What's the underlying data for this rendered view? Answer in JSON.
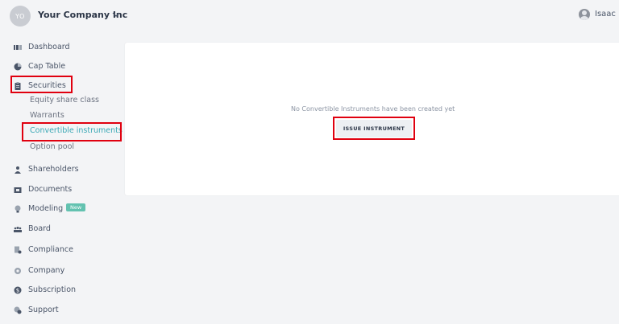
{
  "header": {
    "company_initials": "YO",
    "company_name": "Your Company Inc",
    "user_name": "Isaac"
  },
  "sidebar": {
    "items": [
      {
        "label": "Dashboard",
        "icon": "dashboard-icon"
      },
      {
        "label": "Cap Table",
        "icon": "pie-chart-icon"
      },
      {
        "label": "Securities",
        "icon": "clipboard-icon"
      },
      {
        "label": "Shareholders",
        "icon": "person-icon"
      },
      {
        "label": "Documents",
        "icon": "folder-icon"
      },
      {
        "label": "Modeling",
        "icon": "lightbulb-icon",
        "badge": "New"
      },
      {
        "label": "Board",
        "icon": "group-icon"
      },
      {
        "label": "Compliance",
        "icon": "document-check-icon"
      },
      {
        "label": "Company",
        "icon": "gear-icon"
      },
      {
        "label": "Subscription",
        "icon": "dollar-icon"
      },
      {
        "label": "Support",
        "icon": "support-icon"
      }
    ],
    "securities_sub": [
      {
        "label": "Equity share class"
      },
      {
        "label": "Warrants"
      },
      {
        "label": "Convertible instruments",
        "active": true
      },
      {
        "label": "Option pool"
      }
    ]
  },
  "main": {
    "empty_message": "No Convertible Instruments have been created yet",
    "issue_button_label": "ISSUE INSTRUMENT"
  },
  "colors": {
    "accent": "#3aa8b5",
    "highlight": "#e0000f",
    "badge": "#63c2b0"
  }
}
